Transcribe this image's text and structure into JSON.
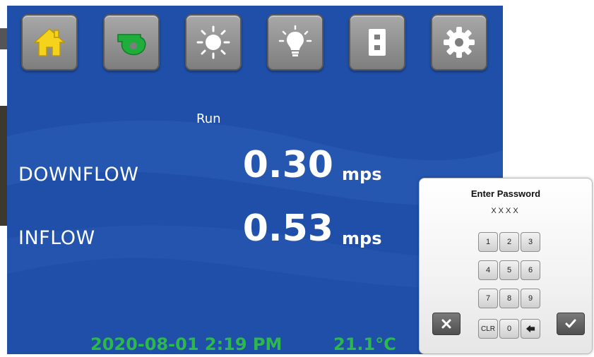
{
  "toolbar": {
    "buttons": [
      {
        "name": "home",
        "icon": "home-icon",
        "color": "#f5d31c"
      },
      {
        "name": "blower",
        "icon": "blower-fan-icon",
        "color": "#1fae3b"
      },
      {
        "name": "uv-light",
        "icon": "sun-icon",
        "color": "#ffffff"
      },
      {
        "name": "light",
        "icon": "light-bulb-icon",
        "color": "#ffffff"
      },
      {
        "name": "outlet",
        "icon": "outlet-icon",
        "color": "#ffffff"
      },
      {
        "name": "settings",
        "icon": "gear-icon",
        "color": "#ffffff"
      }
    ]
  },
  "status": {
    "label": "Run"
  },
  "readings": [
    {
      "label": "DOWNFLOW",
      "value": "0.30",
      "unit": "mps"
    },
    {
      "label": "INFLOW",
      "value": "0.53",
      "unit": "mps"
    }
  ],
  "footer": {
    "datetime": "2020-08-01 2:19 PM",
    "temperature": "21.1°C"
  },
  "colors": {
    "screen_bg": "#1f4fa8",
    "footer_text": "#2db84a"
  },
  "password_dialog": {
    "title": "Enter Password",
    "masked_value": "XXXX",
    "keys": [
      "1",
      "2",
      "3",
      "4",
      "5",
      "6",
      "7",
      "8",
      "9",
      "CLR",
      "0",
      "←"
    ],
    "cancel_icon": "close-icon",
    "confirm_icon": "checkmark-icon"
  }
}
